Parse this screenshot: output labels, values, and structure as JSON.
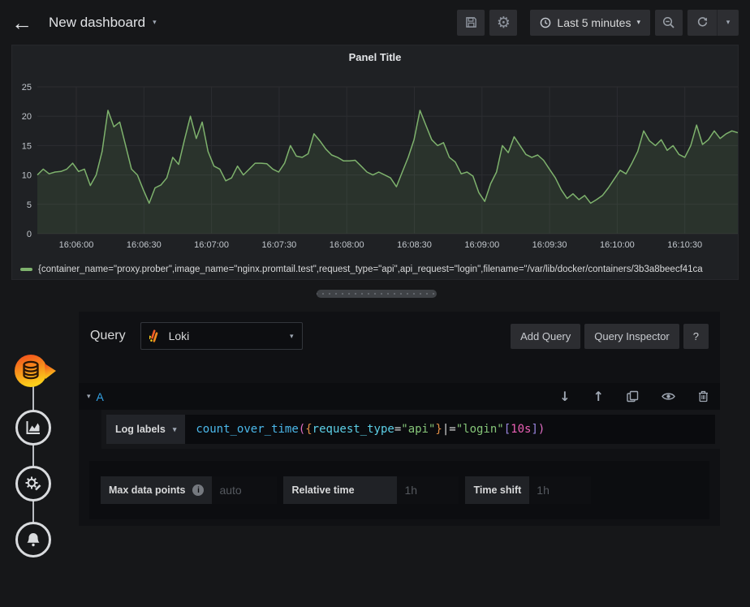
{
  "topbar": {
    "title": "New dashboard",
    "time_picker_label": "Last 5 minutes"
  },
  "panel": {
    "title": "Panel Title"
  },
  "chart_data": {
    "type": "line",
    "title": "Panel Title",
    "x_labels": [
      "16:06:00",
      "16:06:30",
      "16:07:00",
      "16:07:30",
      "16:08:00",
      "16:08:30",
      "16:09:00",
      "16:09:30",
      "16:10:00",
      "16:10:30"
    ],
    "yticks": [
      0,
      5,
      10,
      15,
      20,
      25
    ],
    "ylim": [
      0,
      25
    ],
    "grid": true,
    "legend_position": "bottom-left",
    "line_color": "#7eb26d",
    "fill_color": "rgba(126,178,109,0.12)",
    "series": [
      {
        "name": "{container_name=\"proxy.prober\",image_name=\"nginx.promtail.test\",request_type=\"api\",api_request=\"login\",filename=\"/var/lib/docker/containers/3b3a8beecf41ca",
        "values": [
          10,
          11,
          10.2,
          10.5,
          10.6,
          11,
          12,
          10.6,
          11,
          8.2,
          10,
          14,
          21,
          18.2,
          19,
          15,
          11,
          10,
          7.5,
          5.2,
          7.8,
          8.3,
          9.5,
          13,
          11.8,
          16,
          20,
          16.2,
          19,
          14,
          11.5,
          11,
          9,
          9.5,
          11.5,
          10,
          11,
          12,
          12,
          11.9,
          11,
          10.5,
          12,
          15,
          13.2,
          13,
          13.6,
          17,
          15.8,
          14.4,
          13.4,
          13,
          12.4,
          12.4,
          12.5,
          11.5,
          10.5,
          10,
          10.5,
          10,
          9.5,
          8,
          10.5,
          13,
          16,
          21,
          18.5,
          16,
          15,
          15.5,
          13,
          12.2,
          10.2,
          10.5,
          9.8,
          7,
          5.5,
          8.5,
          10.5,
          15,
          13.8,
          16.5,
          15,
          13.5,
          13,
          13.4,
          12.5,
          11,
          9.5,
          7.5,
          6,
          6.8,
          5.8,
          6.5,
          5.2,
          5.8,
          6.5,
          7.8,
          9.3,
          10.8,
          10.2,
          12,
          14,
          17.5,
          15.8,
          15,
          16,
          14.2,
          15,
          13.5,
          13,
          15,
          18.5,
          15.2,
          16,
          17.5,
          16.2,
          17,
          17.5,
          17.2
        ]
      }
    ]
  },
  "sidebar": {
    "items": [
      {
        "id": "queries",
        "active": true
      },
      {
        "id": "visualization",
        "active": false
      },
      {
        "id": "general",
        "active": false
      },
      {
        "id": "alert",
        "active": false
      }
    ]
  },
  "query": {
    "section_label": "Query",
    "datasource": {
      "name": "Loki"
    },
    "buttons": {
      "add": "Add Query",
      "inspector": "Query Inspector",
      "help": "?"
    },
    "row": {
      "ref_id": "A"
    },
    "log_labels_label": "Log labels",
    "expr": "count_over_time({request_type=\"api\"}|=\"login\"[10s])",
    "expr_tokens": [
      [
        "count_over_time",
        "fn"
      ],
      [
        "(",
        "paren"
      ],
      [
        "{",
        "brace"
      ],
      [
        "request_type",
        "label"
      ],
      [
        "=",
        "op"
      ],
      [
        "\"api\"",
        "string"
      ],
      [
        "}",
        "brace"
      ],
      [
        "|=",
        "op"
      ],
      [
        "\"login\"",
        "string"
      ],
      [
        "[",
        "bracket"
      ],
      [
        "10s",
        "duration"
      ],
      [
        "]",
        "bracket"
      ],
      [
        ")",
        "paren"
      ]
    ],
    "token_colors": {
      "fn": "#4bb8ea",
      "paren": "#e06ec4",
      "brace": "#e08e45",
      "label": "#5ccfe6",
      "op": "#d8d9da",
      "string": "#85c578",
      "bracket": "#9a86e0",
      "duration": "#ea5fb4"
    },
    "options": {
      "max_data_points": {
        "label": "Max data points",
        "placeholder": "auto"
      },
      "relative_time": {
        "label": "Relative time",
        "placeholder": "1h"
      },
      "time_shift": {
        "label": "Time shift",
        "placeholder": "1h"
      }
    }
  },
  "colors": {
    "accent_orange": "#f2681c",
    "accent_yellow": "#fccf1b",
    "series_green": "#7eb26d",
    "ref_id_blue": "#33a2e5"
  }
}
